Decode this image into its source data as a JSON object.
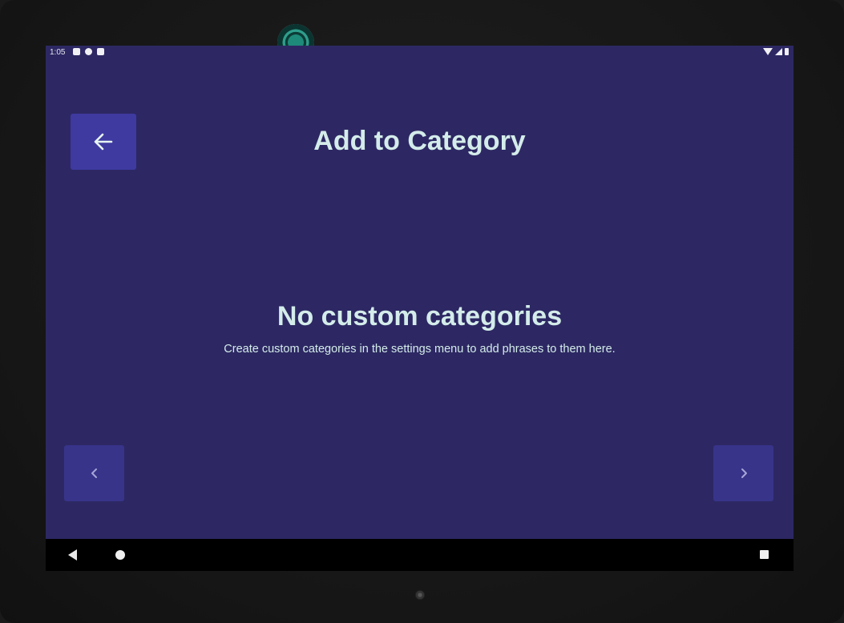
{
  "status_bar": {
    "time": "1:05"
  },
  "header": {
    "title": "Add to Category",
    "back_icon": "arrow-left-icon"
  },
  "empty_state": {
    "title": "No custom categories",
    "subtitle": "Create custom categories in the settings menu to add phrases to them here."
  },
  "pagination": {
    "prev_icon": "chevron-left-icon",
    "next_icon": "chevron-right-icon"
  },
  "colors": {
    "background": "#2d2863",
    "button": "#3e3aa0",
    "button_dim": "#38348a",
    "text": "#d4ecea"
  }
}
